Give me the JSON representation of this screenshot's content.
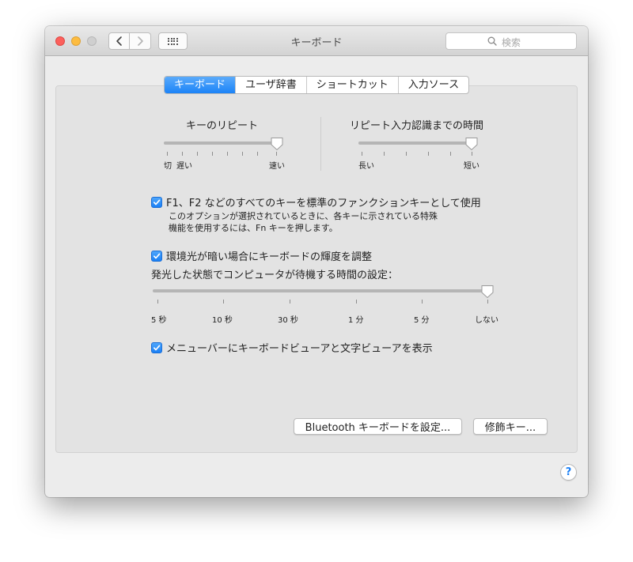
{
  "window": {
    "title": "キーボード"
  },
  "search": {
    "placeholder": "検索"
  },
  "tabs": [
    {
      "label": "キーボード",
      "active": true
    },
    {
      "label": "ユーザ辞書",
      "active": false
    },
    {
      "label": "ショートカット",
      "active": false
    },
    {
      "label": "入力ソース",
      "active": false
    }
  ],
  "key_repeat": {
    "title": "キーのリピート",
    "label_off": "切",
    "label_slow": "遅い",
    "label_fast": "速い",
    "value_fraction": 1.0
  },
  "repeat_delay": {
    "title": "リピート入力認識までの時間",
    "label_long": "長い",
    "label_short": "短い",
    "value_fraction": 1.0
  },
  "fn_option": {
    "checked": true,
    "label": "F1、F2 などのすべてのキーを標準のファンクションキーとして使用",
    "desc_line1": "このオプションが選択されているときに、各キーに示されている特殊",
    "desc_line2": "機能を使用するには、Fn キーを押します。"
  },
  "ambient_option": {
    "checked": true,
    "label": "環境光が暗い場合にキーボードの輝度を調整"
  },
  "backlight_timeout": {
    "title": "発光した状態でコンピュータが待機する時間の設定：",
    "labels": [
      "5 秒",
      "10 秒",
      "30 秒",
      "1 分",
      "5 分",
      "しない"
    ],
    "selected": "しない"
  },
  "menubar_option": {
    "checked": true,
    "label": "メニューバーにキーボードビューアと文字ビューアを表示"
  },
  "buttons": {
    "bluetooth": "Bluetooth キーボードを設定...",
    "modifier": "修飾キー..."
  },
  "help": {
    "label": "?"
  },
  "colors": {
    "accent": "#1a7ff5",
    "close": "#fc605c",
    "minimize": "#fdbc40"
  }
}
